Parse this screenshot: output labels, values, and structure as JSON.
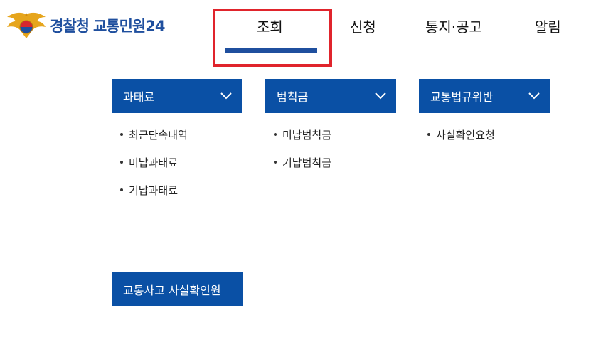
{
  "header": {
    "logo_primary": "경찰청",
    "logo_secondary": "교통민원24"
  },
  "gnb": {
    "items": [
      {
        "label": "조회",
        "active": true
      },
      {
        "label": "신청"
      },
      {
        "label": "통지·공고"
      },
      {
        "label": "알림"
      }
    ],
    "active_color": "#1f4f9e",
    "highlight_color": "#e0242c"
  },
  "submenu": {
    "columns": [
      {
        "title": "과태료",
        "items": [
          "최근단속내역",
          "미납과태료",
          "기납과태료"
        ]
      },
      {
        "title": "범칙금",
        "items": [
          "미납범칙금",
          "기납범칙금"
        ]
      },
      {
        "title": "교통법규위반",
        "items": [
          "사실확인요청"
        ]
      }
    ],
    "accident_button": "교통사고 사실확인원",
    "header_color": "#0a50a5"
  }
}
